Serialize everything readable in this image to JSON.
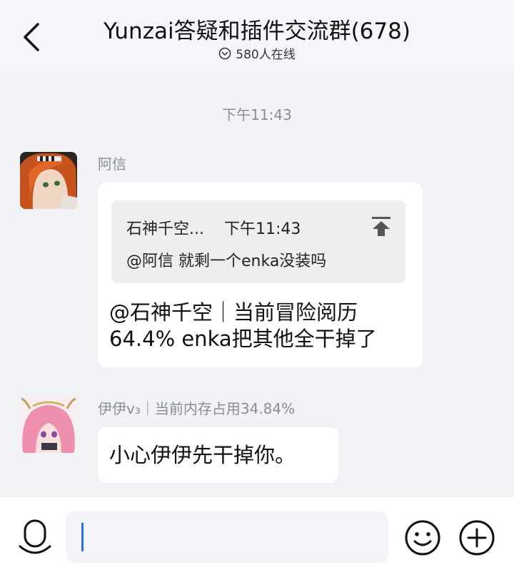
{
  "header": {
    "title": "Yunzai答疑和插件交流群(678)",
    "online_text": "580人在线"
  },
  "time_separator": "下午11:43",
  "messages": [
    {
      "sender": "阿信",
      "quote": {
        "author": "石神千空...",
        "time": "下午11:43",
        "text": "@阿信 就剩一个enka没装吗"
      },
      "lines": [
        "@石神千空｜当前冒险阅历",
        "64.4% enka把其他全干掉了"
      ]
    },
    {
      "sender": "伊伊v₃｜当前内存占用34.84%",
      "lines": [
        "小心伊伊先干掉你。"
      ]
    }
  ],
  "input": {
    "value": "",
    "placeholder": ""
  },
  "colors": {
    "background": "#f1f2f6",
    "header_bg": "#f5f6fa",
    "bubble": "#ffffff",
    "quote_bg": "#eeedf0",
    "meta_text": "#8a8d96",
    "caret": "#2a6fe8"
  }
}
